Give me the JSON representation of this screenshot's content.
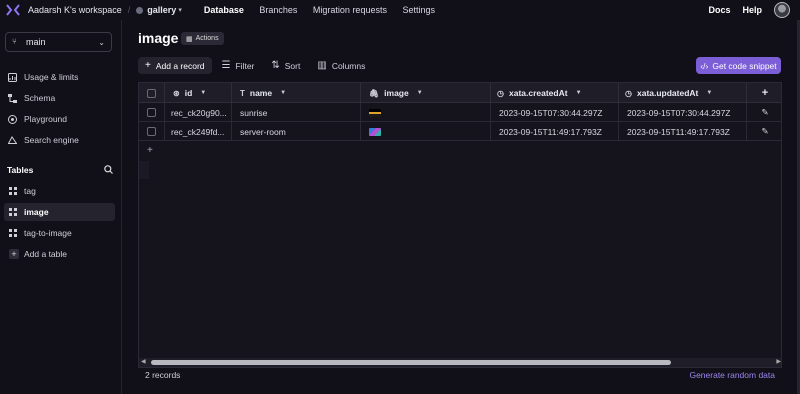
{
  "topbar": {
    "workspace": "Aadarsh K's workspace",
    "database": "gallery",
    "nav": [
      "Database",
      "Branches",
      "Migration requests",
      "Settings"
    ],
    "docs": "Docs",
    "help": "Help"
  },
  "sidebar": {
    "branch": "main",
    "items": [
      "Usage & limits",
      "Schema",
      "Playground",
      "Search engine"
    ],
    "tables_header": "Tables",
    "tables": [
      "tag",
      "image",
      "tag-to-image"
    ],
    "add_table": "Add a table"
  },
  "main": {
    "title": "image",
    "actions": "Actions",
    "toolbar": {
      "add_record": "Add a record",
      "filter": "Filter",
      "sort": "Sort",
      "columns": "Columns"
    },
    "snippet_button": "Get code snippet",
    "columns": [
      "id",
      "name",
      "image",
      "xata.createdAt",
      "xata.updatedAt"
    ],
    "rows": [
      {
        "id": "rec_ck20g90...",
        "name": "sunrise",
        "createdAt": "2023-09-15T07:30:44.297Z",
        "updatedAt": "2023-09-15T07:30:44.297Z"
      },
      {
        "id": "rec_ck249fd...",
        "name": "server-room",
        "createdAt": "2023-09-15T11:49:17.793Z",
        "updatedAt": "2023-09-15T11:49:17.793Z"
      }
    ],
    "record_count": "2 records",
    "generate": "Generate random data"
  },
  "colors": {
    "background": "#111019",
    "accent": "#7c5fd6",
    "link": "#9d86ee"
  }
}
